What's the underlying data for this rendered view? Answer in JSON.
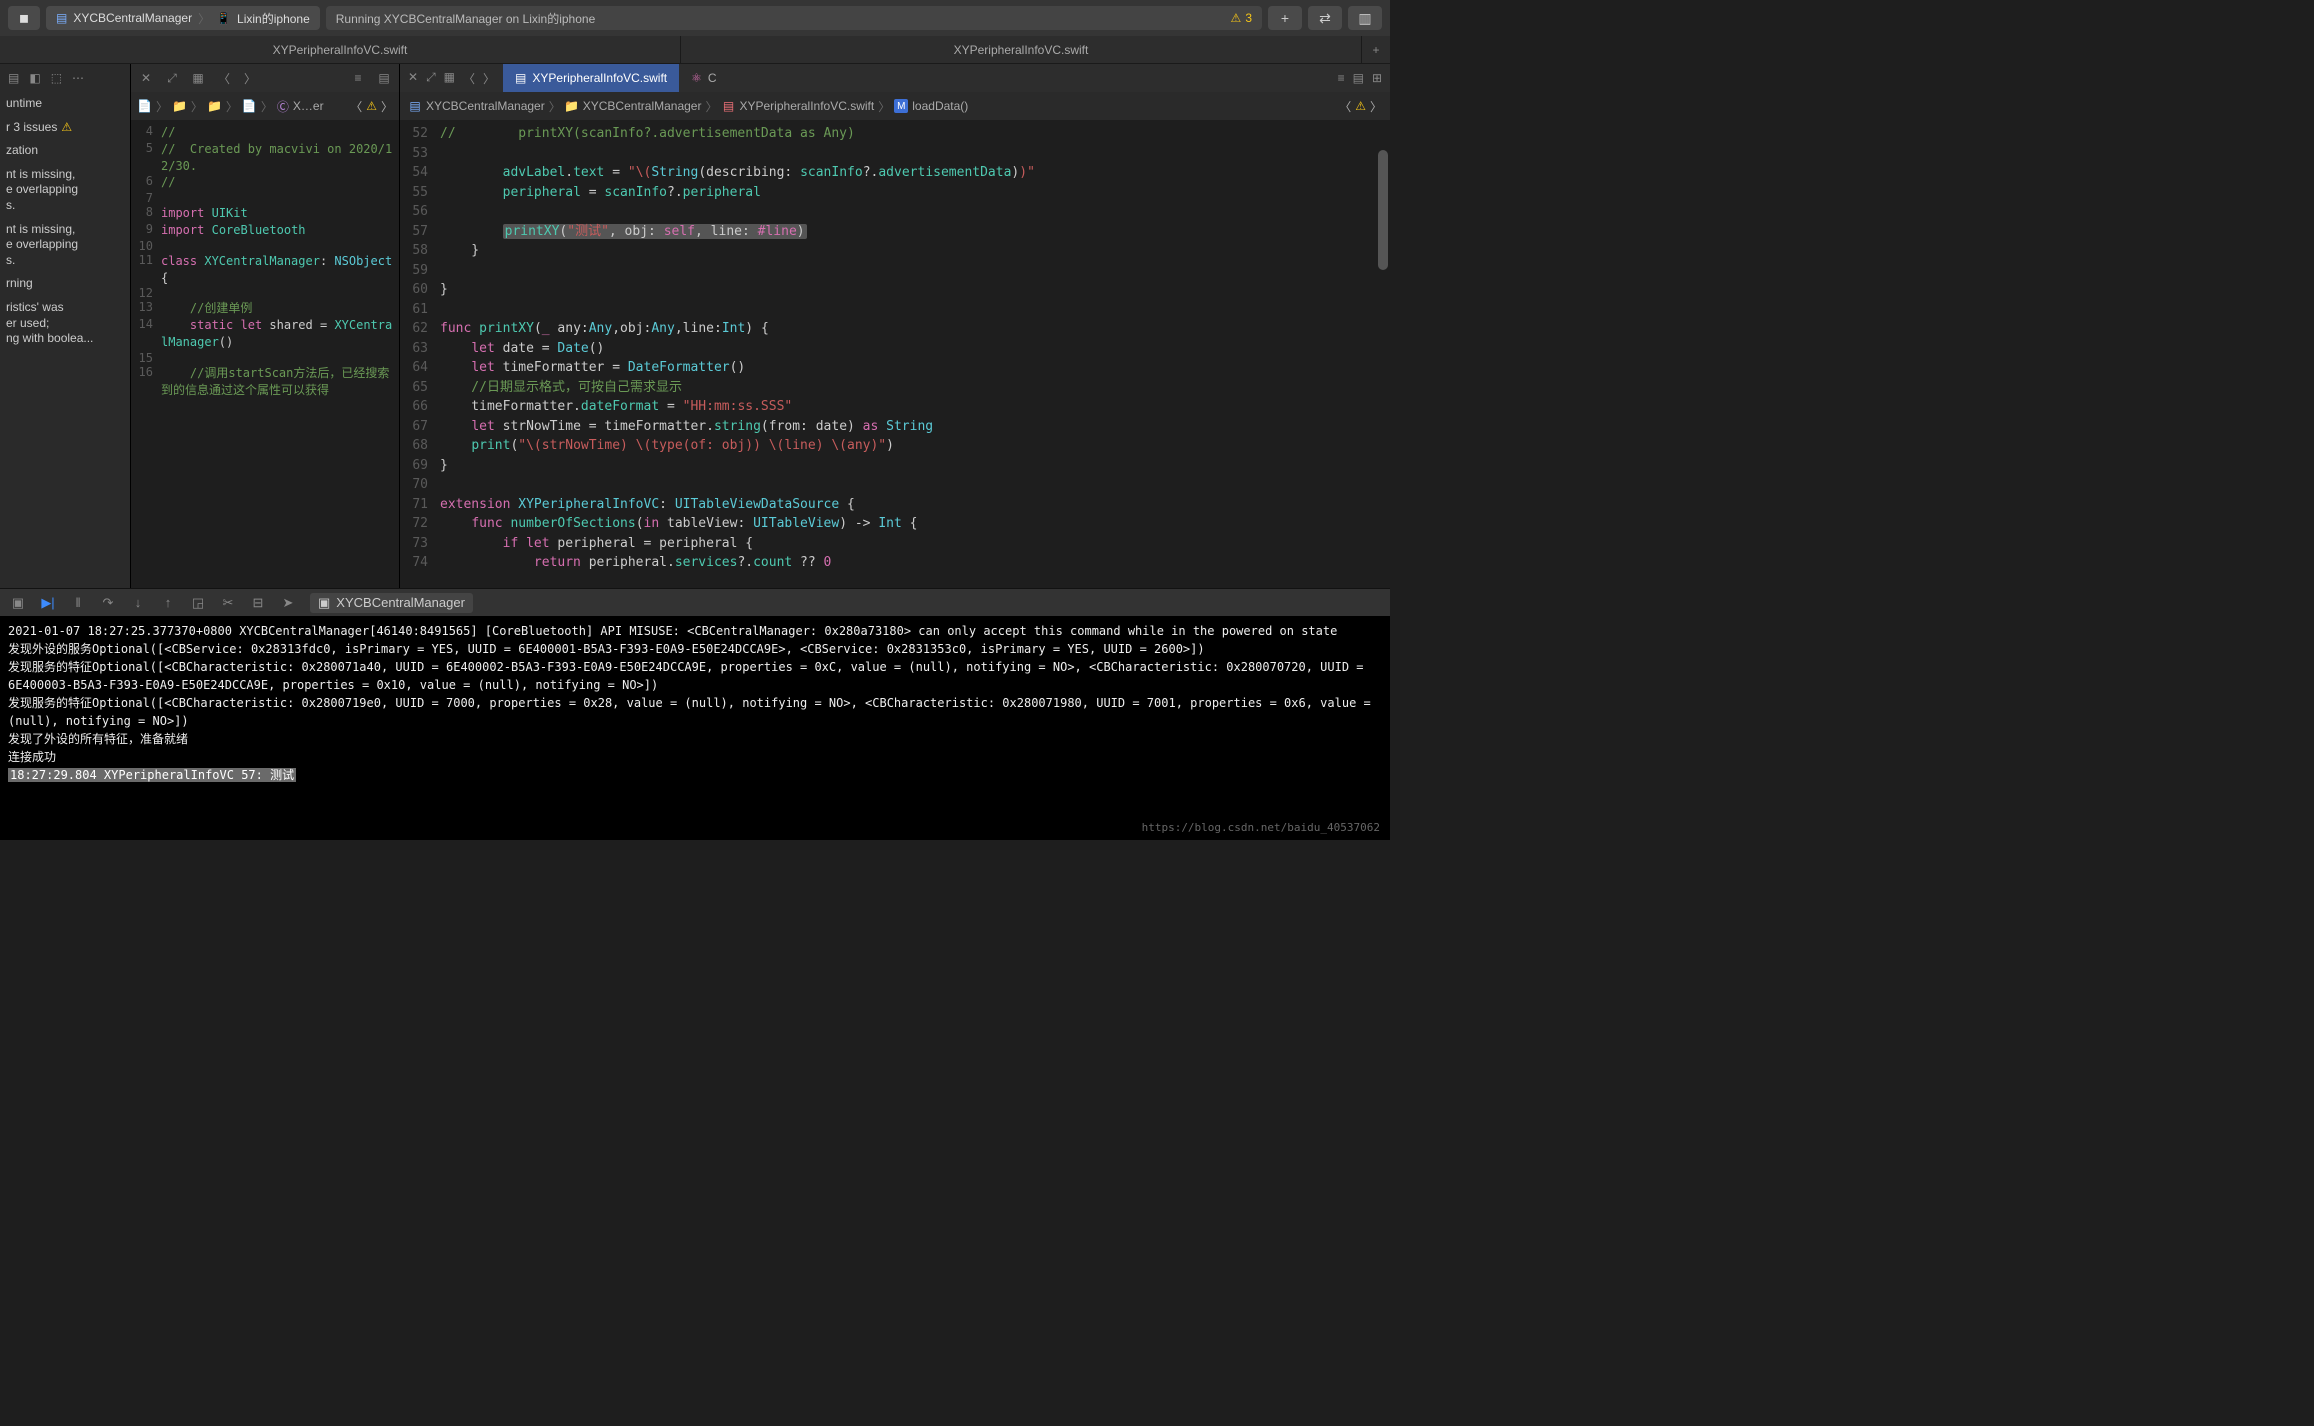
{
  "toolbar": {
    "scheme": "XYCBCentralManager",
    "device": "Lixin的iphone",
    "status": "Running XYCBCentralManager on Lixin的iphone",
    "warn_count": "3"
  },
  "tab_strip": {
    "left": "XYPeripheralInfoVC.swift",
    "right": "XYPeripheralInfoVC.swift"
  },
  "issues": {
    "runtime": "untime",
    "count": "r 3 issues",
    "loc": "zation",
    "msg1a": "nt is missing,",
    "msg1b": "e overlapping",
    "msg1c": "s.",
    "msg2a": "nt is missing,",
    "msg2b": "e overlapping",
    "msg2c": "s.",
    "warn_hdr": "rning",
    "msg3a": "ristics' was",
    "msg3b": "er used;",
    "msg3c": "ng with boolea..."
  },
  "mini": {
    "crumb_trailer": "X…er",
    "lines": [
      {
        "n": "4",
        "t": "//"
      },
      {
        "n": "5",
        "t": "//  Created by macvivi on 2020/12/30."
      },
      {
        "n": "6",
        "t": "//"
      },
      {
        "n": "7",
        "t": ""
      },
      {
        "n": "8",
        "t": "import UIKit"
      },
      {
        "n": "9",
        "t": "import CoreBluetooth"
      },
      {
        "n": "10",
        "t": ""
      },
      {
        "n": "11",
        "t": "class XYCentralManager: NSObject {"
      },
      {
        "n": "12",
        "t": ""
      },
      {
        "n": "13",
        "t": "    //创建单例"
      },
      {
        "n": "14",
        "t": "    static let shared = XYCentralManager()"
      },
      {
        "n": "15",
        "t": ""
      },
      {
        "n": "16",
        "t": "    //调用startScan方法后，已经搜索到的信息通过这个属性可以获得"
      }
    ]
  },
  "editor": {
    "tabs": {
      "active": "XYPeripheralInfoVC.swift",
      "other": "C"
    },
    "crumbs": {
      "c1": "XYCBCentralManager",
      "c2": "XYCBCentralManager",
      "c3": "XYPeripheralInfoVC.swift",
      "c4": "loadData()"
    },
    "code": [
      {
        "n": 52,
        "t": "//        printXY(scanInfo?.advertisementData as Any)",
        "cls": "c-comment"
      },
      {
        "n": 53,
        "t": "",
        "cls": ""
      },
      {
        "n": 54,
        "t": "        advLabel.text = \"\\(String(describing: scanInfo?.advertisementData))\"",
        "cls": "raw54"
      },
      {
        "n": 55,
        "t": "        peripheral = scanInfo?.peripheral",
        "cls": "raw55"
      },
      {
        "n": 56,
        "t": "",
        "cls": ""
      },
      {
        "n": 57,
        "t": "        printXY(\"测试\", obj: self, line: #line)",
        "cls": "raw57"
      },
      {
        "n": 58,
        "t": "    }",
        "cls": "c-white"
      },
      {
        "n": 59,
        "t": "",
        "cls": ""
      },
      {
        "n": 60,
        "t": "}",
        "cls": "c-white"
      },
      {
        "n": 61,
        "t": "",
        "cls": ""
      },
      {
        "n": 62,
        "t": "func printXY(_ any:Any,obj:Any,line:Int) {",
        "cls": "raw62"
      },
      {
        "n": 63,
        "t": "    let date = Date()",
        "cls": "raw63"
      },
      {
        "n": 64,
        "t": "    let timeFormatter = DateFormatter()",
        "cls": "raw64"
      },
      {
        "n": 65,
        "t": "    //日期显示格式，可按自己需求显示",
        "cls": "c-comment"
      },
      {
        "n": 66,
        "t": "    timeFormatter.dateFormat = \"HH:mm:ss.SSS\"",
        "cls": "raw66"
      },
      {
        "n": 67,
        "t": "    let strNowTime = timeFormatter.string(from: date) as String",
        "cls": "raw67"
      },
      {
        "n": 68,
        "t": "    print(\"\\(strNowTime) \\(type(of: obj)) \\(line) \\(any)\")",
        "cls": "raw68"
      },
      {
        "n": 69,
        "t": "}",
        "cls": "c-white"
      },
      {
        "n": 70,
        "t": "",
        "cls": ""
      },
      {
        "n": 71,
        "t": "extension XYPeripheralInfoVC: UITableViewDataSource {",
        "cls": "raw71"
      },
      {
        "n": 72,
        "t": "    func numberOfSections(in tableView: UITableView) -> Int {",
        "cls": "raw72"
      },
      {
        "n": 73,
        "t": "        if let peripheral = peripheral {",
        "cls": "raw73"
      },
      {
        "n": 74,
        "t": "            return peripheral.services?.count ?? 0",
        "cls": "raw74"
      }
    ]
  },
  "debug": {
    "app": "XYCBCentralManager"
  },
  "console": {
    "l1": "2021-01-07 18:27:25.377370+0800 XYCBCentralManager[46140:8491565] [CoreBluetooth] API MISUSE: <CBCentralManager: 0x280a73180> can only accept this command while in the powered on state",
    "l2": "发现外设的服务Optional([<CBService: 0x28313fdc0, isPrimary = YES, UUID = 6E400001-B5A3-F393-E0A9-E50E24DCCA9E>, <CBService: 0x2831353c0, isPrimary = YES, UUID = 2600>])",
    "l3": "发现服务的特征Optional([<CBCharacteristic: 0x280071a40, UUID = 6E400002-B5A3-F393-E0A9-E50E24DCCA9E, properties = 0xC, value = (null), notifying = NO>, <CBCharacteristic: 0x280070720, UUID = 6E400003-B5A3-F393-E0A9-E50E24DCCA9E, properties = 0x10, value = (null), notifying = NO>])",
    "l4": "发现服务的特征Optional([<CBCharacteristic: 0x2800719e0, UUID = 7000, properties = 0x28, value = (null), notifying = NO>, <CBCharacteristic: 0x280071980, UUID = 7001, properties = 0x6, value = (null), notifying = NO>])",
    "l5": "发现了外设的所有特征，准备就绪",
    "l6": "连接成功",
    "l7": "18:27:29.804 XYPeripheralInfoVC 57:  测试",
    "watermark": "https://blog.csdn.net/baidu_40537062"
  }
}
